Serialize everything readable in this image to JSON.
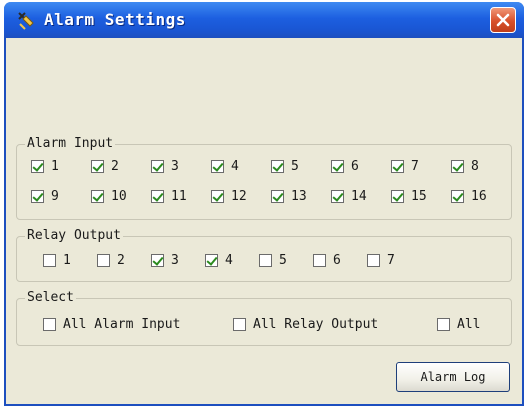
{
  "window": {
    "title": "Alarm Settings"
  },
  "alarm_input": {
    "legend": "Alarm Input",
    "items": [
      {
        "label": "1",
        "checked": true
      },
      {
        "label": "2",
        "checked": true
      },
      {
        "label": "3",
        "checked": true
      },
      {
        "label": "4",
        "checked": true
      },
      {
        "label": "5",
        "checked": true
      },
      {
        "label": "6",
        "checked": true
      },
      {
        "label": "7",
        "checked": true
      },
      {
        "label": "8",
        "checked": true
      },
      {
        "label": "9",
        "checked": true
      },
      {
        "label": "10",
        "checked": true
      },
      {
        "label": "11",
        "checked": true
      },
      {
        "label": "12",
        "checked": true
      },
      {
        "label": "13",
        "checked": true
      },
      {
        "label": "14",
        "checked": true
      },
      {
        "label": "15",
        "checked": true
      },
      {
        "label": "16",
        "checked": true
      }
    ]
  },
  "relay_output": {
    "legend": "Relay Output",
    "items": [
      {
        "label": "1",
        "checked": false
      },
      {
        "label": "2",
        "checked": false
      },
      {
        "label": "3",
        "checked": true
      },
      {
        "label": "4",
        "checked": true
      },
      {
        "label": "5",
        "checked": false
      },
      {
        "label": "6",
        "checked": false
      },
      {
        "label": "7",
        "checked": false
      }
    ]
  },
  "select": {
    "legend": "Select",
    "all_alarm_input": {
      "label": "All Alarm Input",
      "checked": false
    },
    "all_relay_output": {
      "label": "All Relay Output",
      "checked": false
    },
    "all": {
      "label": "All",
      "checked": false
    }
  },
  "footer": {
    "alarm_log_label": "Alarm Log"
  }
}
